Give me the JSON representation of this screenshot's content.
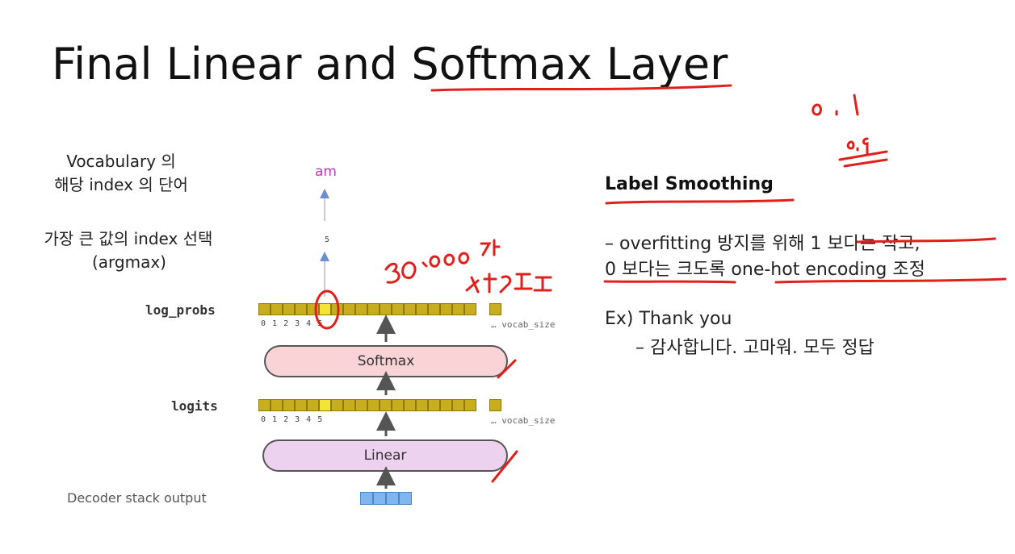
{
  "title": "Final Linear and Softmax Layer",
  "left_notes": {
    "vocab_line1": "Vocabulary 의",
    "vocab_line2": "해당 index 의 단어",
    "argmax_line1": "가장 큰 값의 index 선택",
    "argmax_line2": "(argmax)"
  },
  "diagram": {
    "output_word": "am",
    "selected_index": "5",
    "log_probs_label": "log_probs",
    "logits_label": "logits",
    "decoder_label": "Decoder stack output",
    "softmax_label": "Softmax",
    "linear_label": "Linear",
    "ticks_log_probs": "0 1 2 3 4 5",
    "ticks_logits": "0 1 2 3 4 5",
    "vocab_size": "… vocab_size"
  },
  "right": {
    "heading": "Label Smoothing",
    "line1": "– overfitting 방지를 위해 1 보다는 작고,",
    "line2": "0 보다는 크도록 one-hot encoding 조정",
    "example": "Ex) Thank you",
    "example_detail": "– 감사합니다. 고마워. 모두 정답"
  },
  "colors": {
    "annotation": "#e0201a",
    "cell": "#c8ae1e",
    "cell_highlight": "#f5e23a",
    "decoder_cell": "#7fb6ef",
    "softmax_fill": "#f9d3d6",
    "linear_fill": "#edd2f0",
    "output_word": "#b23db2"
  }
}
